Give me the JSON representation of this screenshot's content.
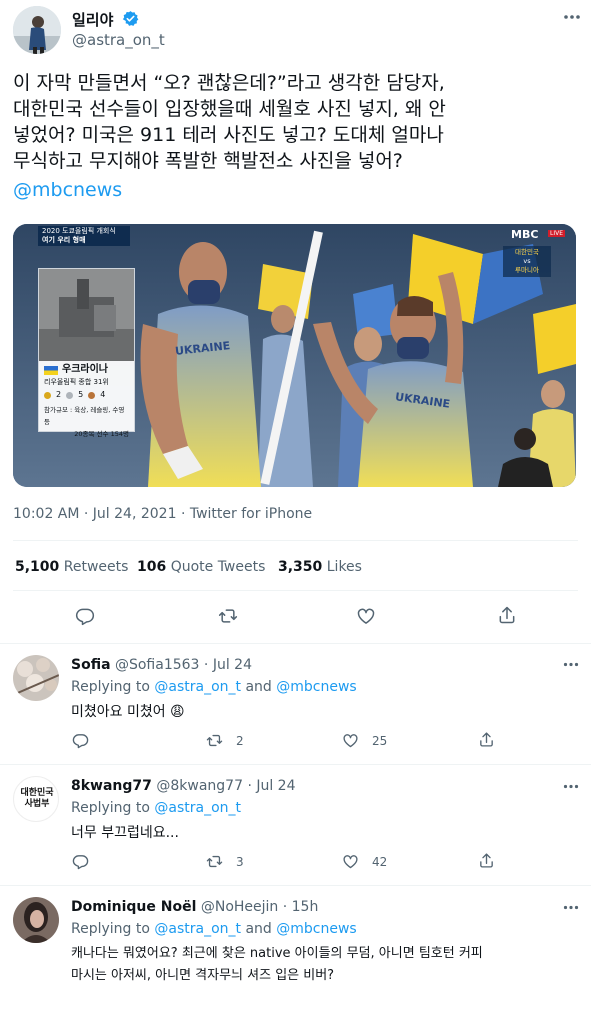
{
  "main_tweet": {
    "display_name": "일리야",
    "handle": "@astra_on_t",
    "text_lines": [
      "이 자막 만들면서 “오? 괜찮은데?”라고 생각한 담당자,",
      "대한민국 선수들이 입장했을때 세월호 사진 넣지, 왜 안",
      "넣었어? 미국은 911 테러 사진도 넣고? 도대체 얼마나",
      "무식하고 무지해야 폭발한 핵발전소 사진을 넣어?"
    ],
    "mention": "@mbcnews",
    "timestamp": "10:02 AM · Jul 24, 2021 · Twitter for iPhone",
    "stats": {
      "retweets_value": "5,100",
      "retweets_label": "Retweets",
      "quotes_value": "106",
      "quotes_label": "Quote Tweets",
      "likes_value": "3,350",
      "likes_label": "Likes"
    },
    "media": {
      "caption_top_small": "2020 도쿄올림픽 개회식",
      "caption_top": "여기 우리 형매",
      "country_name": "우크라이나",
      "olympic_rank": "리우올림픽 종합 31위",
      "medal_gold": "2",
      "medal_silver": "5",
      "medal_bronze": "4",
      "participation": "참가규모 : 육상, 레슬링, 수영 등",
      "athletes": "20종목 선수 154명",
      "shirt_text": "UKRAINE",
      "broadcaster": "MBC",
      "live_badge": "LIVE",
      "side_caption_1": "대한민국",
      "side_caption_2": "vs",
      "side_caption_3": "루마니아"
    }
  },
  "replies": [
    {
      "display_name": "Sofia",
      "handle": "@Sofia1563",
      "date": "· Jul 24",
      "replying_prefix": "Replying to",
      "replying_to_1": "@astra_on_t",
      "replying_and": "and",
      "replying_to_2": "@mbcnews",
      "text": "미쳤아요 미쳤어 😩",
      "retweets": "2",
      "likes": "25"
    },
    {
      "display_name": "8kwang77",
      "handle": "@8kwang77",
      "date": "· Jul 24",
      "replying_prefix": "Replying to",
      "replying_to_1": "@astra_on_t",
      "text": "너무 부끄럽네요...",
      "retweets": "3",
      "likes": "42",
      "avatar_text_1": "대한민국",
      "avatar_text_2": "사법부"
    },
    {
      "display_name": "Dominique Noël",
      "handle": "@NoHeejin",
      "date": "· 15h",
      "replying_prefix": "Replying to",
      "replying_to_1": "@astra_on_t",
      "replying_and": "and",
      "replying_to_2": "@mbcnews",
      "text_lines": [
        "캐나다는 뭐였어요? 최근에 찾은 native 아이들의 무덤, 아니면 팀호턴 커피",
        "마시는 아저씨, 아니면 격자무늬 셔즈 입은 비버?"
      ]
    }
  ],
  "colors": {
    "accent": "#1d9bf0",
    "text": "#0f1419",
    "muted": "#536471",
    "divider": "#eff3f4"
  }
}
